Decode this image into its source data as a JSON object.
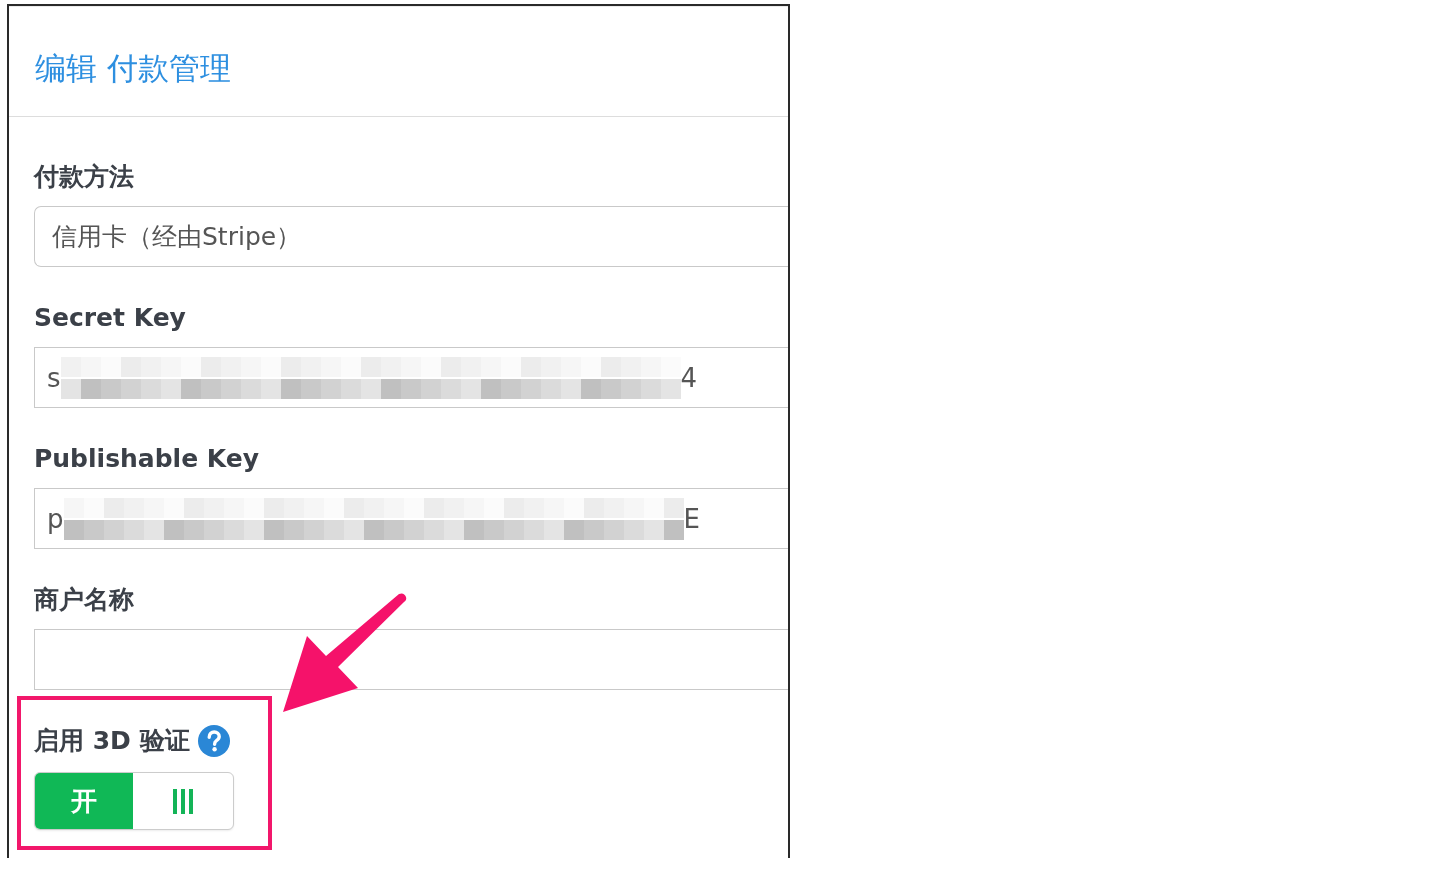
{
  "panel": {
    "title": "编辑 付款管理"
  },
  "fields": [
    {
      "kind": "static",
      "label": "付款方法",
      "value": "信用卡（经由Stripe）"
    },
    {
      "kind": "redacted",
      "label": "Secret Key",
      "value_start": "s",
      "value_end": "4"
    },
    {
      "kind": "redacted",
      "label": "Publishable Key",
      "value_start": "p",
      "value_end": "E"
    },
    {
      "kind": "text",
      "label": "商户名称"
    }
  ],
  "three_d": {
    "label": "启用 3D 验证",
    "highlighted": true,
    "toggle": {
      "on": true,
      "on_label": "开"
    }
  },
  "pointer_arrow": true
}
